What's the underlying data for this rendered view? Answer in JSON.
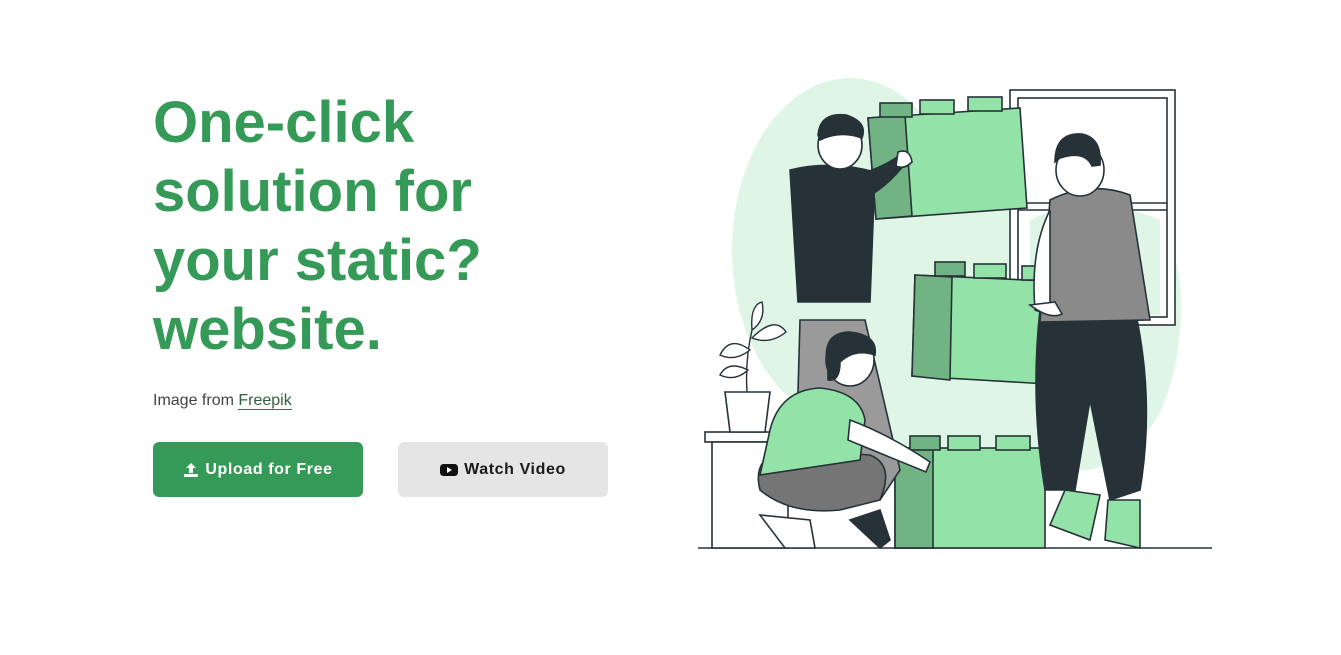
{
  "hero": {
    "headline_lines": [
      "One-click",
      "solution for",
      "your static?",
      "website."
    ],
    "credit_prefix": "Image from ",
    "credit_link": "Freepik"
  },
  "buttons": {
    "upload_label": "Upload for Free",
    "upload_icon": "upload-icon",
    "watch_label": "Watch Video",
    "watch_icon": "youtube-play-icon"
  },
  "colors": {
    "brand_green": "#359a57",
    "light_green": "#93e3a9",
    "mid_green": "#72b383",
    "pale_green": "#dff6e6",
    "dark": "#263238",
    "button_grey": "#e5e5e5"
  },
  "illustration": {
    "icon": "people-stacking-blocks-illustration"
  }
}
